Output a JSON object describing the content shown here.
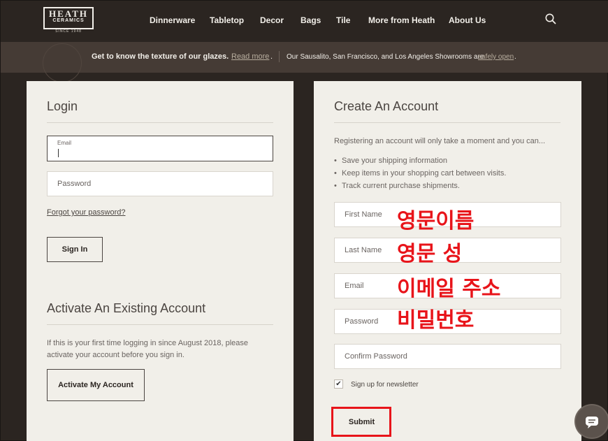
{
  "logo": {
    "line1": "HEATH",
    "line2": "CERAMICS",
    "line3": "SINCE 1948"
  },
  "nav": {
    "items": [
      "Dinnerware",
      "Tabletop",
      "Decor",
      "Bags",
      "Tile",
      "More from Heath",
      "About Us"
    ],
    "search_icon": "search-icon"
  },
  "promo": {
    "text1": "Get to know the texture of our glazes.",
    "link1": "Read more",
    "text2": "Our Sausalito, San Francisco, and Los Angeles Showrooms are",
    "link2": "safely open"
  },
  "login": {
    "title": "Login",
    "email_label": "Email",
    "password_placeholder": "Password",
    "forgot": "Forgot your password?",
    "sign_in": "Sign In"
  },
  "activate": {
    "title": "Activate An Existing Account",
    "text": "If this is your first time logging in since August 2018, please activate your account before you sign in.",
    "button": "Activate My Account"
  },
  "create": {
    "title": "Create An Account",
    "intro": "Registering an account will only take a moment and you can...",
    "bullets": [
      "Save your shipping information",
      "Keep items in your shopping cart between visits.",
      "Track current purchase shipments."
    ],
    "first_name": "First Name",
    "last_name": "Last Name",
    "email": "Email",
    "password": "Password",
    "confirm_password": "Confirm Password",
    "newsletter": "Sign up for newsletter",
    "newsletter_checked": true,
    "submit": "Submit"
  },
  "annotations": {
    "first_name": "영문이름",
    "last_name": "영문 성",
    "email": "이메일 주소",
    "password": "비밀번호",
    "color": "#e8141a"
  },
  "chat_icon": "chat-bubble-icon"
}
